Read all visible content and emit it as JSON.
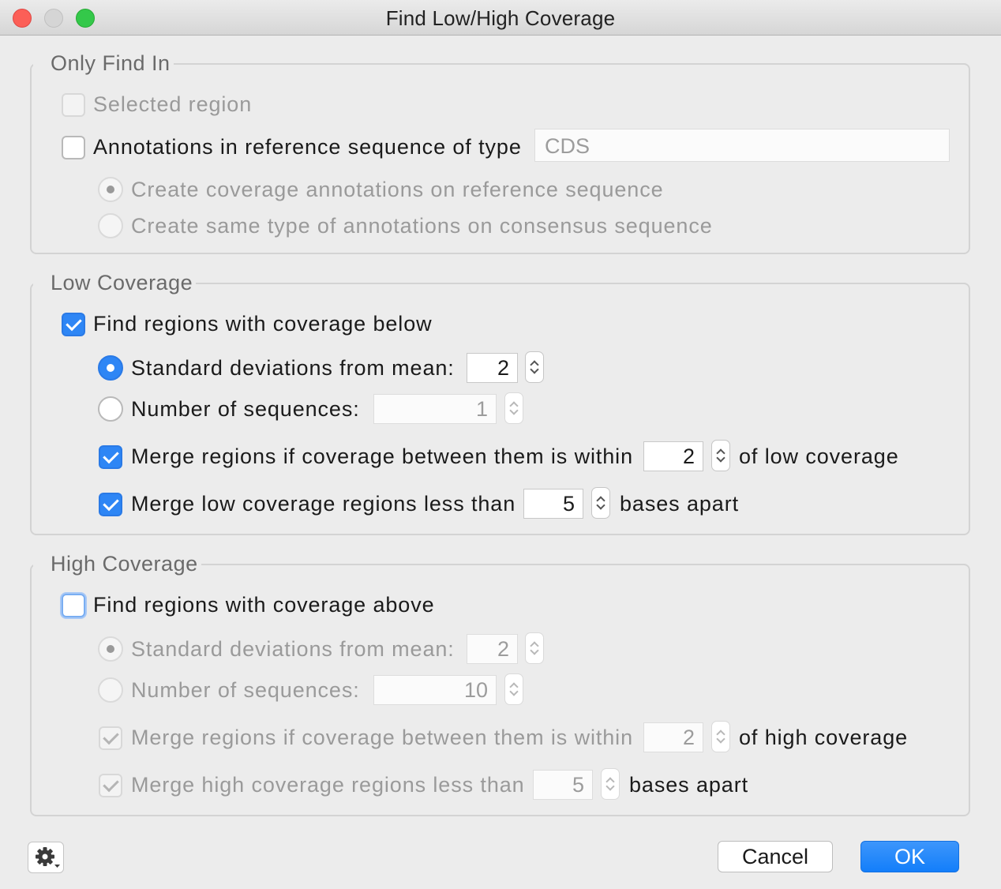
{
  "window": {
    "title": "Find Low/High Coverage"
  },
  "only_find_in": {
    "legend": "Only Find In",
    "selected_region": {
      "label": "Selected region",
      "checked": false,
      "enabled": false
    },
    "annotations": {
      "label": "Annotations in reference sequence of type",
      "checked": false,
      "type_value": "CDS"
    },
    "create_on_reference": {
      "label": "Create coverage annotations on reference sequence",
      "selected": true,
      "enabled": false
    },
    "create_on_consensus": {
      "label": "Create same type of annotations on consensus sequence",
      "selected": false,
      "enabled": false
    }
  },
  "low_coverage": {
    "legend": "Low Coverage",
    "find": {
      "label": "Find regions with coverage below",
      "checked": true
    },
    "std_dev": {
      "label": "Standard deviations from mean:",
      "selected": true,
      "value": "2"
    },
    "num_seq": {
      "label": "Number of sequences:",
      "selected": false,
      "value": "1"
    },
    "merge_within": {
      "label": "Merge regions if coverage between them is within",
      "checked": true,
      "value": "2",
      "suffix": "of low coverage"
    },
    "merge_apart": {
      "label": "Merge low coverage regions less than",
      "checked": true,
      "value": "5",
      "suffix": "bases apart"
    }
  },
  "high_coverage": {
    "legend": "High Coverage",
    "find": {
      "label": "Find regions with coverage above",
      "checked": false
    },
    "std_dev": {
      "label": "Standard deviations from mean:",
      "selected": true,
      "value": "2"
    },
    "num_seq": {
      "label": "Number of sequences:",
      "selected": false,
      "value": "10"
    },
    "merge_within": {
      "label": "Merge regions if coverage between them is within",
      "checked": true,
      "value": "2",
      "suffix": "of high coverage"
    },
    "merge_apart": {
      "label": "Merge high coverage regions less than",
      "checked": true,
      "value": "5",
      "suffix": "bases apart"
    }
  },
  "buttons": {
    "cancel": "Cancel",
    "ok": "OK",
    "options_icon": "gear-icon"
  },
  "colors": {
    "accent": "#2e86f5",
    "close": "#fc5f57",
    "zoom": "#34c84a"
  }
}
